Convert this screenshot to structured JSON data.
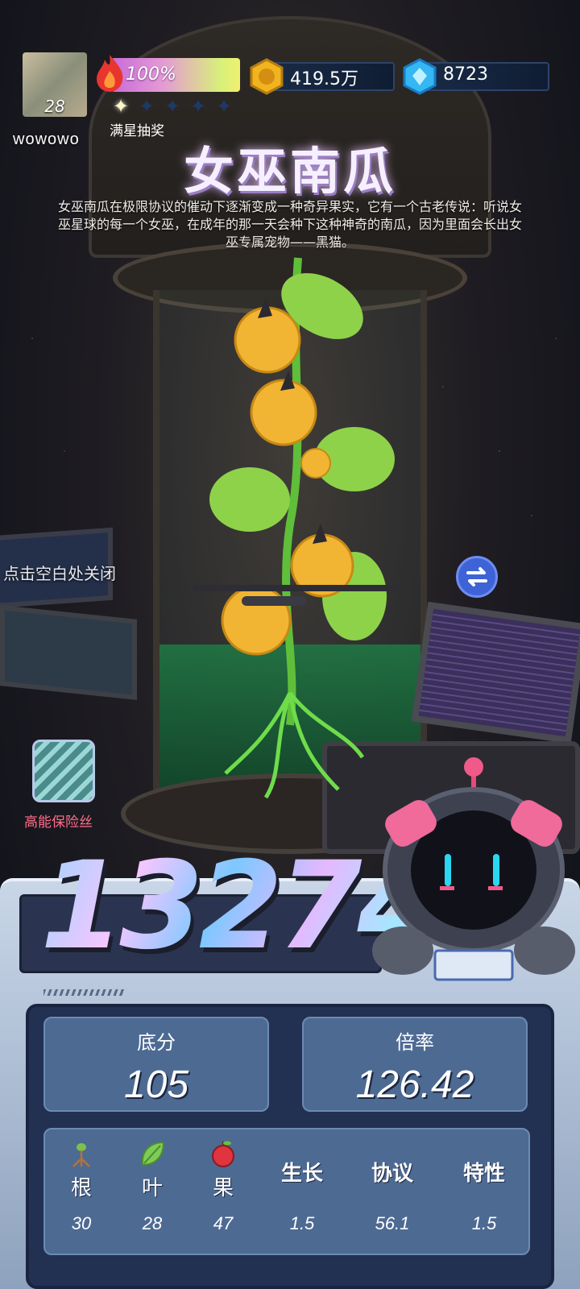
{
  "player": {
    "level": "28",
    "username": "wowowo"
  },
  "heat": {
    "value": "100%",
    "progress": 1.0,
    "stars": [
      true,
      false,
      false,
      false,
      false
    ],
    "stars_label": "满星抽奖"
  },
  "currency": {
    "coins": "419.5万",
    "gems": "8723"
  },
  "item": {
    "title": "女巫南瓜",
    "description": "女巫南瓜在极限协议的催动下逐渐变成一种奇异果实，它有一个古老传说：听说女巫星球的每一个女巫，在成年的那一天会种下这种神奇的南瓜，因为里面会长出女巫专属宠物——黑猫。"
  },
  "hints": {
    "close": "点击空白处关闭"
  },
  "fuse": {
    "label": "高能保险丝"
  },
  "score": {
    "total": "13274"
  },
  "stats": {
    "base_label": "底分",
    "base_value": "105",
    "mult_label": "倍率",
    "mult_value": "126.42"
  },
  "attributes": [
    {
      "label": "根",
      "value": "30",
      "icon": "root-icon"
    },
    {
      "label": "叶",
      "value": "28",
      "icon": "leaf-icon"
    },
    {
      "label": "果",
      "value": "47",
      "icon": "apple-icon"
    },
    {
      "label": "生长",
      "value": "1.5"
    },
    {
      "label": "协议",
      "value": "56.1"
    },
    {
      "label": "特性",
      "value": "1.5"
    }
  ],
  "colors": {
    "accent_pink": "#ff6e8a",
    "panel_blue": "#4d6a93",
    "swap_button": "#3e63d6"
  }
}
